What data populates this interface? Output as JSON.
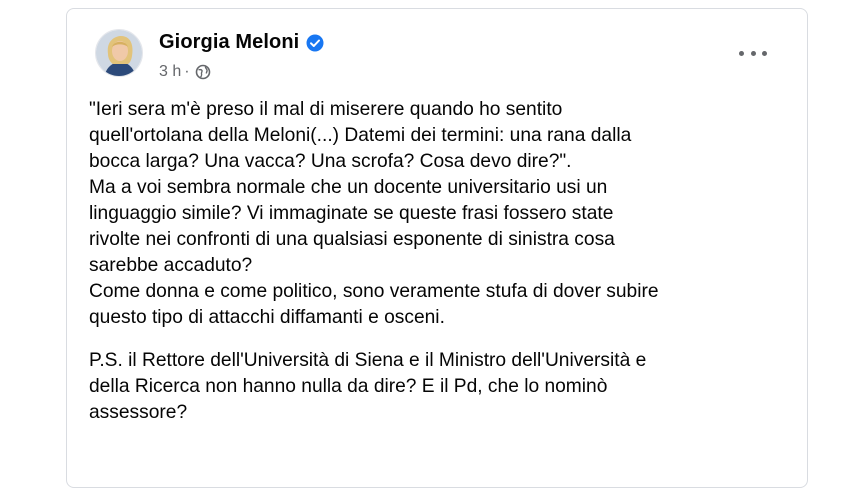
{
  "post": {
    "author": "Giorgia Meloni",
    "time": "3 h",
    "separator": "·",
    "paragraph1_lines": [
      "\"Ieri sera m'è preso il mal di miserere quando ho sentito",
      "quell'ortolana della Meloni(...) Datemi dei termini: una rana dalla",
      "bocca larga? Una vacca? Una scrofa? Cosa devo dire?\".",
      "Ma a voi sembra normale che un docente universitario usi un",
      "linguaggio simile? Vi immaginate se queste frasi fossero state",
      "rivolte nei confronti di una qualsiasi esponente di sinistra cosa",
      "sarebbe accaduto?",
      "Come donna e come politico, sono veramente stufa di dover subire",
      "questo tipo di attacchi diffamanti e osceni."
    ],
    "paragraph2_lines": [
      "P.S. il Rettore dell'Università di Siena e il Ministro dell'Università e",
      "della Ricerca non hanno nulla da dire? E il Pd, che lo nominò",
      "assessore?"
    ]
  },
  "icons": {
    "verified": "verified-badge-icon",
    "privacy": "globe-icon",
    "more": "more-options-icon"
  },
  "colors": {
    "text": "#050505",
    "secondary_text": "#65676b",
    "verified_blue": "#1877f2",
    "card_border": "#d9dce1"
  }
}
